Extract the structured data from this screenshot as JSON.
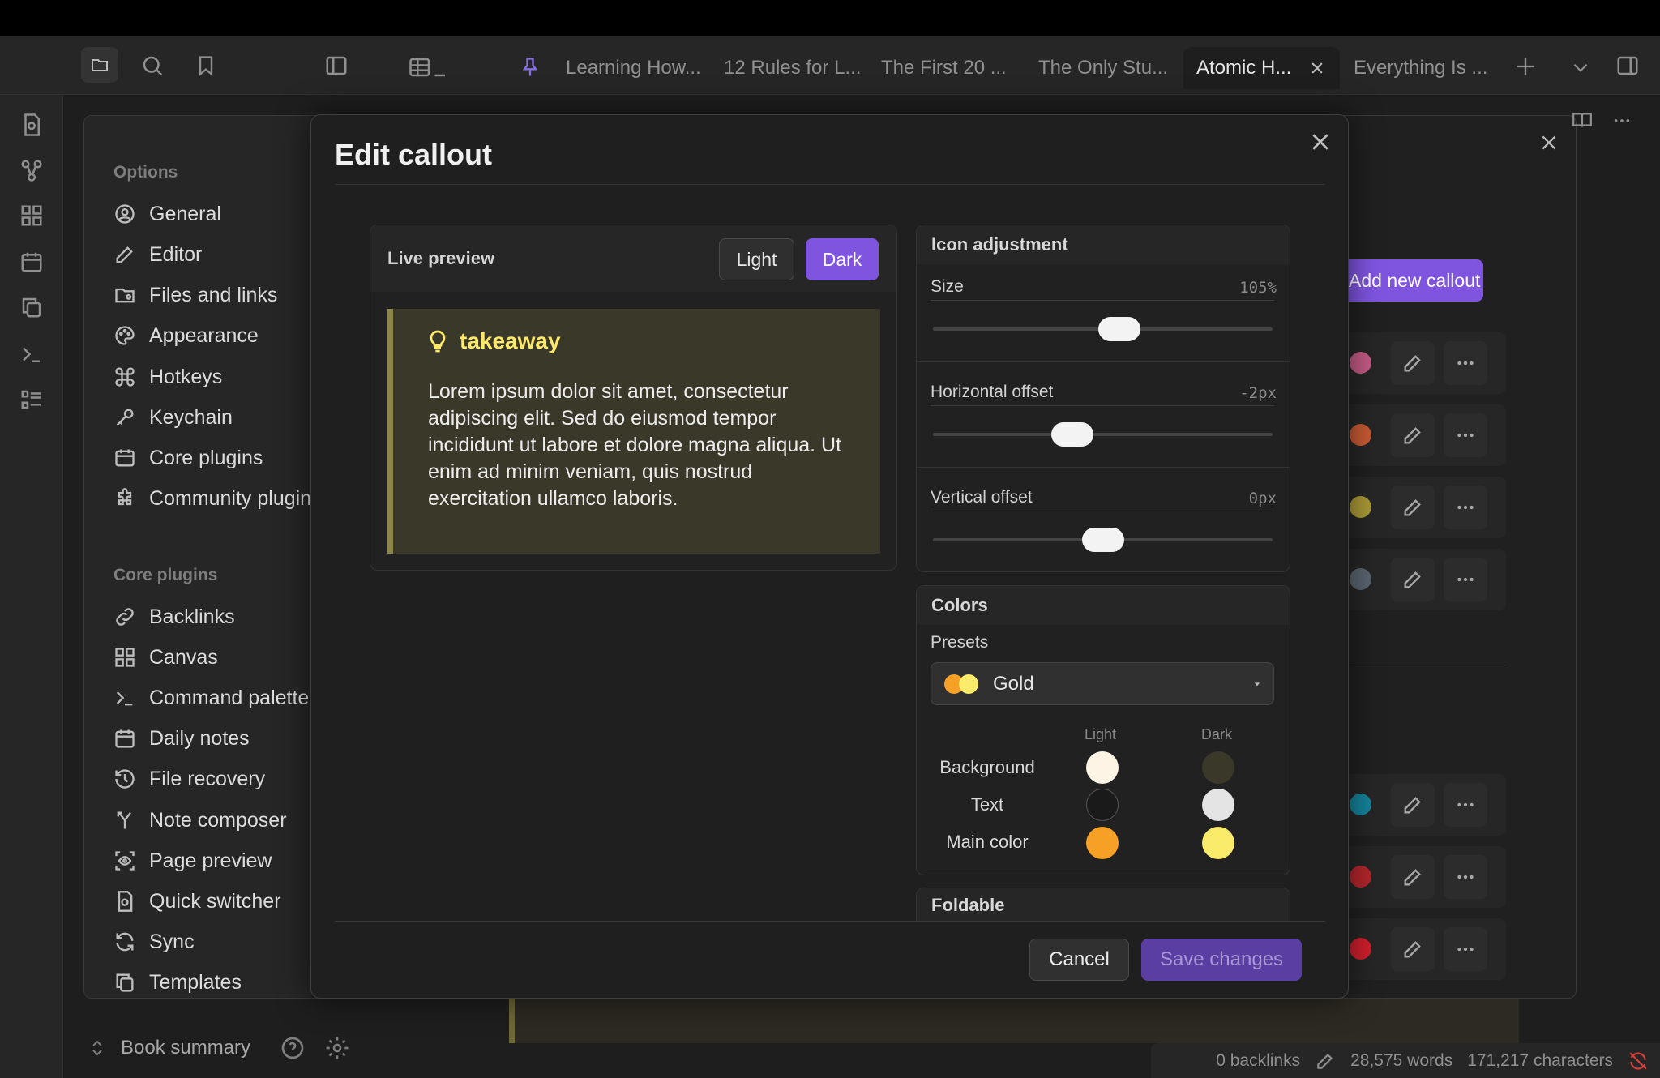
{
  "tabs": [
    {
      "label": "Learning How..."
    },
    {
      "label": "12 Rules for L..."
    },
    {
      "label": "The First 20 ..."
    },
    {
      "label": "The Only Stu..."
    },
    {
      "label": "Atomic H...",
      "active": true
    },
    {
      "label": "Everything Is ..."
    }
  ],
  "settings": {
    "options_heading": "Options",
    "options": [
      {
        "label": "General",
        "icon": "user-circle-icon"
      },
      {
        "label": "Editor",
        "icon": "pencil-icon"
      },
      {
        "label": "Files and links",
        "icon": "folder-cog-icon"
      },
      {
        "label": "Appearance",
        "icon": "palette-icon"
      },
      {
        "label": "Hotkeys",
        "icon": "command-icon"
      },
      {
        "label": "Keychain",
        "icon": "key-icon"
      },
      {
        "label": "Core plugins",
        "icon": "calendar-box-icon"
      },
      {
        "label": "Community plugins",
        "icon": "puzzle-icon"
      }
    ],
    "core_heading": "Core plugins",
    "core": [
      {
        "label": "Backlinks",
        "icon": "link-icon"
      },
      {
        "label": "Canvas",
        "icon": "grid-icon"
      },
      {
        "label": "Command palette",
        "icon": "terminal-icon"
      },
      {
        "label": "Daily notes",
        "icon": "calendar-icon"
      },
      {
        "label": "File recovery",
        "icon": "history-icon"
      },
      {
        "label": "Note composer",
        "icon": "merge-icon"
      },
      {
        "label": "Page preview",
        "icon": "scan-eye-icon"
      },
      {
        "label": "Quick switcher",
        "icon": "file-search-icon"
      },
      {
        "label": "Sync",
        "icon": "sync-icon"
      },
      {
        "label": "Templates",
        "icon": "copy-icon"
      }
    ],
    "add_callout": "Add new callout",
    "callout_colors": [
      "#c45b86",
      "#c85a34",
      "#a99a37",
      "#5a6570",
      "#15829a",
      "#b3262c",
      "#cf1f2b"
    ]
  },
  "vault": {
    "name": "Book summary"
  },
  "status": {
    "backlinks": "0 backlinks",
    "words": "28,575 words",
    "characters": "171,217 characters"
  },
  "modal": {
    "title": "Edit callout",
    "preview": {
      "label": "Live preview",
      "light_label": "Light",
      "dark_label": "Dark",
      "mode": "Dark",
      "callout_icon": "lightbulb-icon",
      "callout_title": "takeaway",
      "callout_body": "Lorem ipsum dolor sit amet, consectetur adipiscing elit. Sed do eiusmod tempor incididunt ut labore et dolore magna aliqua. Ut enim ad minim veniam, quis nostrud exercitation ullamco laboris."
    },
    "icon_adjustment": {
      "heading": "Icon adjustment",
      "size": {
        "label": "Size",
        "value": "105%",
        "fraction": 0.55
      },
      "horizontal": {
        "label": "Horizontal offset",
        "value": "-2px",
        "fraction": 0.41
      },
      "vertical": {
        "label": "Vertical offset",
        "value": "0px",
        "fraction": 0.5
      }
    },
    "colors": {
      "heading": "Colors",
      "presets_label": "Presets",
      "preset": "Gold",
      "light_col": "Light",
      "dark_col": "Dark",
      "rows": [
        {
          "label": "Background",
          "light": "#fdf4e6",
          "dark": "#3a3829"
        },
        {
          "label": "Text",
          "light": "#1a1a1a",
          "dark": "#e4e4e4"
        },
        {
          "label": "Main color",
          "light": "#f6a126",
          "dark": "#fbeb6b"
        }
      ]
    },
    "foldable_heading": "Foldable",
    "cancel": "Cancel",
    "save": "Save changes"
  },
  "colors": {
    "accent": "#7f55e0",
    "save_disabled": "#5b3ea1"
  }
}
